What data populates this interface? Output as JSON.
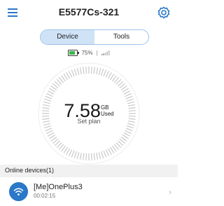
{
  "header": {
    "title": "E5577Cs-321",
    "menu_icon": "hamburger-menu-icon",
    "settings_icon": "gear-icon"
  },
  "tabs": [
    {
      "label": "Device",
      "active": true
    },
    {
      "label": "Tools",
      "active": false
    }
  ],
  "status": {
    "battery_percent": "75%",
    "battery_level": 0.75,
    "separator": "|",
    "signal_icon": "signal-bars-icon"
  },
  "usage": {
    "value": "7.58",
    "unit": "GB",
    "unit_sub": "Used",
    "set_plan_label": "Set plan"
  },
  "online_devices": {
    "header": "Online devices(1)",
    "items": [
      {
        "name": "[Me]OnePlus3",
        "duration": "00:02:15",
        "icon": "wifi-icon"
      }
    ]
  },
  "colors": {
    "accent": "#2a78c8",
    "tab_active_bg": "#cfe2f6",
    "battery_fill": "#3bb54a"
  }
}
